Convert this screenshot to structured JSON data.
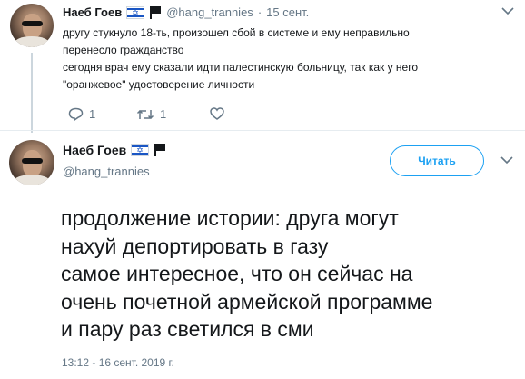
{
  "reply_tweet": {
    "name": "Наеб Гоев",
    "handle": "@hang_trannies",
    "separator": "·",
    "date": "15 сент.",
    "lines": [
      "другу стукнуло 18-ть, произошел сбой в системе и ему неправильно",
      "перенесло гражданство",
      "сегодня врач ему сказали идти палестинскую больницу, так как у него",
      "\"оранжевое\" удостоверение личности"
    ],
    "reply_count": "1",
    "retweet_count": "1"
  },
  "main_tweet": {
    "name": "Наеб Гоев",
    "handle": "@hang_trannies",
    "follow_label": "Читать",
    "lines": [
      "продолжение истории: друга могут",
      "нахуй депортировать в газу",
      "самое интересное, что он сейчас на",
      "очень почетной армейской программе",
      "и пару раз светился в сми"
    ],
    "timestamp": "13:12 - 16 сент. 2019 г."
  },
  "colors": {
    "text": "#14171a",
    "secondary": "#657786",
    "accent": "#1da1f2",
    "divider": "#e6ecf0"
  },
  "icons": [
    "reply-icon",
    "retweet-icon",
    "like-icon",
    "chevron-down-icon",
    "israel-flag-icon",
    "black-flag-icon"
  ]
}
